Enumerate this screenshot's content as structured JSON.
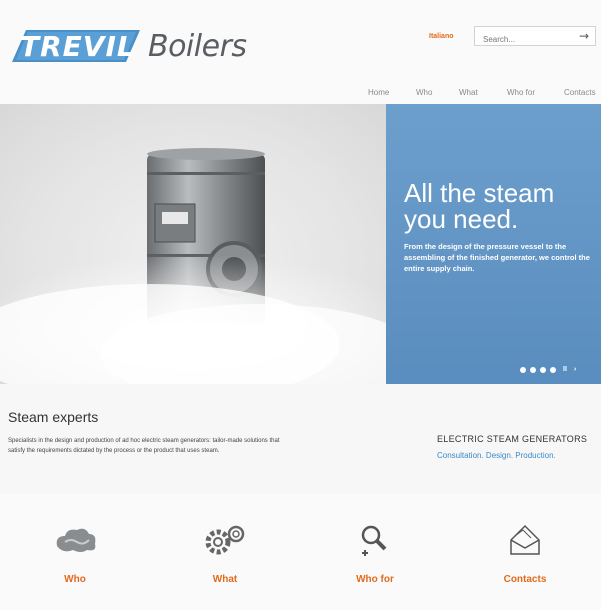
{
  "header": {
    "logo_text": "TREVIL",
    "logo_suffix": "Boilers",
    "language": "Italiano",
    "search_placeholder": "Search...",
    "search_submit_icon": "arrow-right-icon"
  },
  "nav": {
    "items": [
      "Home",
      "Who",
      "What",
      "Who for",
      "Contacts"
    ]
  },
  "hero": {
    "title": "All the steam you need.",
    "text": "From the design of the pressure vessel to the assembling of the finished generator, we control the entire supply chain.",
    "slides_count": 4,
    "pause_label": "II",
    "next_label": "›"
  },
  "intro": {
    "title": "Steam experts",
    "text": "Specialists in the design and production of ad hoc electric steam generators: tailor-made solutions that satisfy the requirements dictated by the process or the product that uses steam.",
    "right_title": "ELECTRIC STEAM GENERATORS",
    "right_sub": "Consultation. Design. Production."
  },
  "features": [
    {
      "label": "Who",
      "icon": "steam-cloud-icon"
    },
    {
      "label": "What",
      "icon": "gears-icon"
    },
    {
      "label": "Who for",
      "icon": "person-search-icon"
    },
    {
      "label": "Contacts",
      "icon": "envelope-icon"
    }
  ],
  "colors": {
    "accent": "#e26b1c",
    "blue": "#5a8dbf",
    "link_blue": "#3a8ac9"
  }
}
